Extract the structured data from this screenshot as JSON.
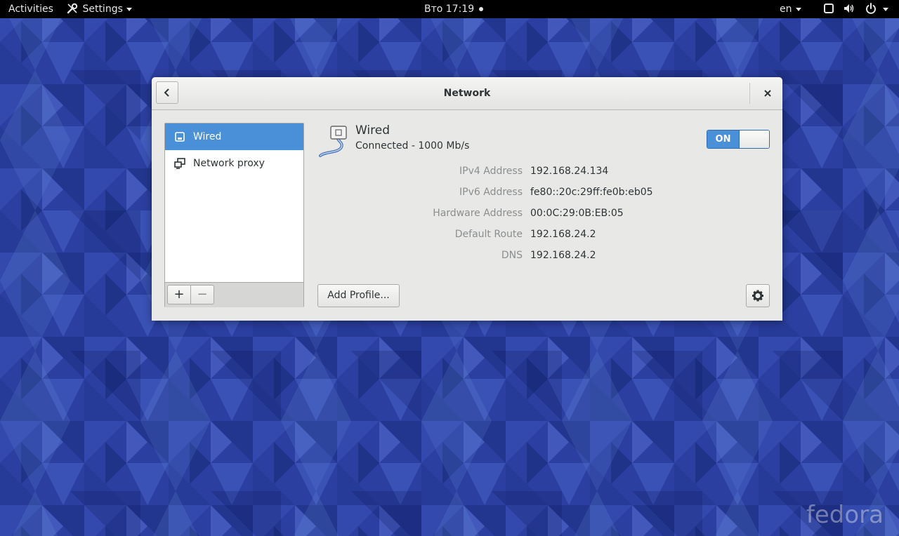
{
  "colors": {
    "accent": "#4a90d9",
    "desktop": "#2a3e9e",
    "topbar": "#000000"
  },
  "topbar": {
    "activities": "Activities",
    "app_menu": "Settings",
    "app_menu_icon": "tools-icon",
    "clock": "Вто 17:19",
    "keyboard_layout": "en"
  },
  "window": {
    "title": "Network",
    "sidebar": {
      "items": [
        {
          "label": "Wired",
          "icon": "wired-network-icon",
          "selected": true
        },
        {
          "label": "Network proxy",
          "icon": "network-proxy-icon",
          "selected": false
        }
      ],
      "add_label": "+",
      "remove_label": "−"
    },
    "device": {
      "name": "Wired",
      "status": "Connected - 1000 Mb/s",
      "switch_label": "ON",
      "details": [
        {
          "label": "IPv4 Address",
          "value": "192.168.24.134"
        },
        {
          "label": "IPv6 Address",
          "value": "fe80::20c:29ff:fe0b:eb05"
        },
        {
          "label": "Hardware Address",
          "value": "00:0C:29:0B:EB:05"
        },
        {
          "label": "Default Route",
          "value": "192.168.24.2"
        },
        {
          "label": "DNS",
          "value": "192.168.24.2"
        }
      ],
      "add_profile_label": "Add Profile..."
    }
  },
  "desktop": {
    "watermark": "fedora"
  }
}
